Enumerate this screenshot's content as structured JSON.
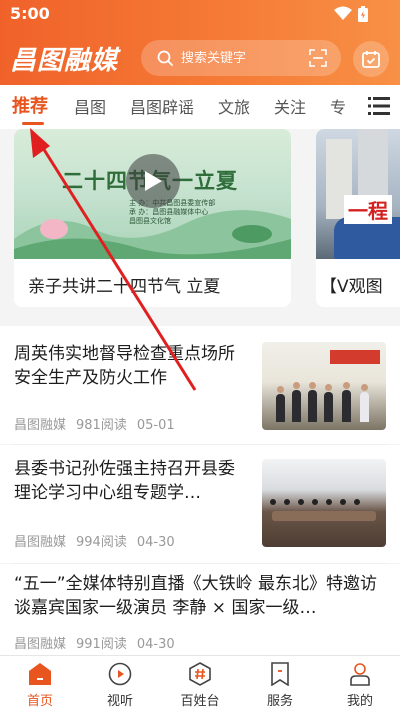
{
  "status_bar": {
    "time": "5:00"
  },
  "header": {
    "logo_text": "昌图融媒",
    "search": {
      "placeholder": "搜索关键字"
    }
  },
  "tabs": [
    {
      "label": "推荐",
      "active": true
    },
    {
      "label": "昌图"
    },
    {
      "label": "昌图辟谣"
    },
    {
      "label": "文旅"
    },
    {
      "label": "关注"
    },
    {
      "label": "专"
    }
  ],
  "carousel": [
    {
      "title": "亲子共讲二十四节气 立夏",
      "thumb_caption": "二十四节气一立夏",
      "thumb_small": "主 办：中共昌图县委宣传部\n承 办：昌图县融媒体中心\n昌图县文化馆",
      "has_video": true
    },
    {
      "title": "【V观图",
      "thumb_sign": "一程"
    }
  ],
  "news": [
    {
      "title": "周英伟实地督导检查重点场所安全生产及防火工作",
      "source": "昌图融媒",
      "reads": "981阅读",
      "date": "05-01"
    },
    {
      "title": "县委书记孙佐强主持召开县委理论学习中心组专题学…",
      "source": "昌图融媒",
      "reads": "994阅读",
      "date": "04-30"
    },
    {
      "title": "“五一”全媒体特别直播《大铁岭 最东北》特邀访谈嘉宾国家一级演员 李静 × 国家一级…",
      "source": "昌图融媒",
      "reads": "991阅读",
      "date": "04-30"
    }
  ],
  "bottom_nav": [
    {
      "label": "首页",
      "icon": "home-icon",
      "active": true
    },
    {
      "label": "视听",
      "icon": "play-circle-icon"
    },
    {
      "label": "百姓台",
      "icon": "hashtag-icon"
    },
    {
      "label": "服务",
      "icon": "bookmark-icon"
    },
    {
      "label": "我的",
      "icon": "user-icon"
    }
  ],
  "colors": {
    "accent": "#e8551e",
    "header_start": "#f0622a",
    "header_end": "#f89046",
    "annotation_arrow": "#e02020"
  }
}
